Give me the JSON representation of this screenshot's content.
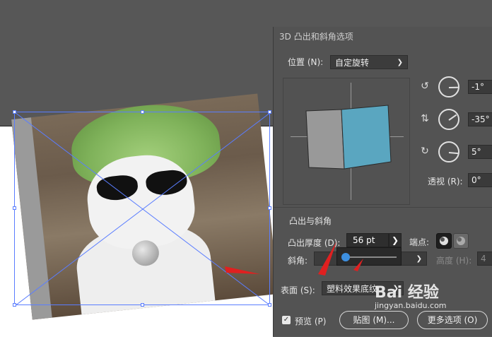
{
  "dialog": {
    "title": "3D 凸出和斜角选项",
    "position_label": "位置 (N):",
    "position_value": "自定旋转",
    "rotation": [
      {
        "icon": "rotate-x-icon",
        "value": "-1°",
        "angle_deg": -1
      },
      {
        "icon": "rotate-y-icon",
        "value": "-35°",
        "angle_deg": -35
      },
      {
        "icon": "rotate-z-icon",
        "value": "5°",
        "angle_deg": 5
      }
    ],
    "perspective_label": "透视 (R):",
    "perspective_value": "0°",
    "extrude_section_title": "凸出与斜角",
    "extrude_depth_label": "凸出厚度 (D):",
    "extrude_depth_value": "56 pt",
    "cap_label": "端点:",
    "bevel_label": "斜角:",
    "height_label": "高度 (H):",
    "height_value": "4",
    "surface_label": "表面 (S):",
    "surface_value": "塑料效果底纹",
    "preview_label": "预览 (P)",
    "map_button": "贴图 (M)...",
    "more_options_button": "更多选项 (O)",
    "slider_level": 0.05
  },
  "colors": {
    "dialog_bg": "#535353",
    "cube_front": "#5aa6c0",
    "cube_side": "#999999",
    "selection": "#5a7dff",
    "annotation_arrow": "#e02020"
  },
  "watermark": {
    "text": "Bai 经验",
    "url": "jingyan.baidu.com"
  }
}
